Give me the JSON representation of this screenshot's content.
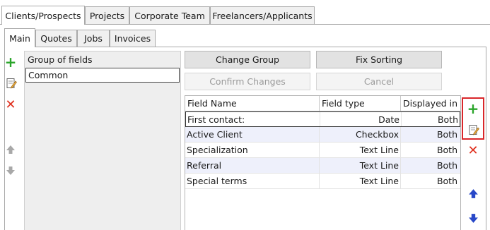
{
  "outer_tabs": [
    {
      "label": "Clients/Prospects"
    },
    {
      "label": "Projects"
    },
    {
      "label": "Corporate Team"
    },
    {
      "label": "Freelancers/Applicants"
    }
  ],
  "inner_tabs": [
    {
      "label": "Main"
    },
    {
      "label": "Quotes"
    },
    {
      "label": "Jobs"
    },
    {
      "label": "Invoices"
    }
  ],
  "groups": {
    "header": "Group of fields",
    "items": [
      {
        "label": "Common"
      }
    ]
  },
  "buttons": {
    "change_group": "Change Group",
    "fix_sorting": "Fix Sorting",
    "confirm_changes": "Confirm Changes",
    "cancel": "Cancel"
  },
  "grid": {
    "columns": [
      "Field Name",
      "Field type",
      "Displayed in"
    ],
    "rows": [
      [
        "First contact:",
        "Date",
        "Both"
      ],
      [
        "Active Client",
        "Checkbox",
        "Both"
      ],
      [
        "Specialization",
        "Text Line",
        "Both"
      ],
      [
        "Referral",
        "Text Line",
        "Both"
      ],
      [
        "Special terms",
        "Text Line",
        "Both"
      ]
    ]
  },
  "icons": {
    "add": "plus-icon",
    "edit": "edit-icon",
    "delete": "delete-icon",
    "up": "arrow-up-icon",
    "down": "arrow-down-icon"
  },
  "colors": {
    "add": "#2aa52a",
    "delete": "#e0301e",
    "arrow_active": "#2848c8",
    "arrow_inactive": "#a8a8a8",
    "highlight_box": "#d9262a",
    "row_alt": "#eef0fb"
  }
}
